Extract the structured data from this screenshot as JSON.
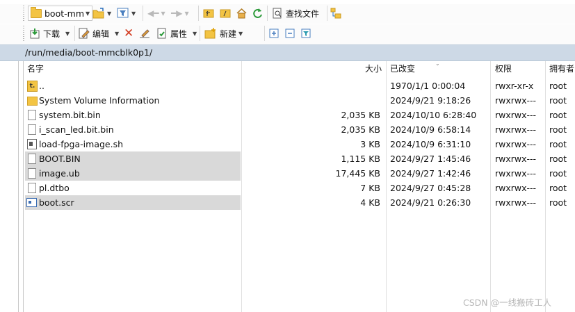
{
  "toolbar1": {
    "drive_label": "boot-mm",
    "find_files_label": "查找文件"
  },
  "toolbar2": {
    "download_label": "下载",
    "edit_label": "编辑",
    "properties_label": "属性",
    "new_label": "新建"
  },
  "path": "/run/media/boot-mmcblk0p1/",
  "columns": {
    "name": "名字",
    "size": "大小",
    "modified": "已改变",
    "permissions": "权限",
    "owner": "拥有者"
  },
  "files": [
    {
      "name": "..",
      "size": "",
      "modified": "1970/1/1 0:00:04",
      "perms": "rwxr-xr-x",
      "owner": "root",
      "icon": "parent-folder-icon",
      "selected": false
    },
    {
      "name": "System Volume Information",
      "size": "",
      "modified": "2024/9/21 9:18:26",
      "perms": "rwxrwx---",
      "owner": "root",
      "icon": "folder-icon",
      "selected": false
    },
    {
      "name": "system.bit.bin",
      "size": "2,035 KB",
      "modified": "2024/10/10 6:28:40",
      "perms": "rwxrwx---",
      "owner": "root",
      "icon": "file-icon",
      "selected": false
    },
    {
      "name": "i_scan_led.bit.bin",
      "size": "2,035 KB",
      "modified": "2024/10/9 6:58:14",
      "perms": "rwxrwx---",
      "owner": "root",
      "icon": "file-icon",
      "selected": false
    },
    {
      "name": "load-fpga-image.sh",
      "size": "3 KB",
      "modified": "2024/10/9 6:31:10",
      "perms": "rwxrwx---",
      "owner": "root",
      "icon": "script-icon",
      "selected": false
    },
    {
      "name": "BOOT.BIN",
      "size": "1,115 KB",
      "modified": "2024/9/27 1:45:46",
      "perms": "rwxrwx---",
      "owner": "root",
      "icon": "file-icon",
      "selected": true
    },
    {
      "name": "image.ub",
      "size": "17,445 KB",
      "modified": "2024/9/27 1:42:46",
      "perms": "rwxrwx---",
      "owner": "root",
      "icon": "file-icon",
      "selected": true
    },
    {
      "name": "pl.dtbo",
      "size": "7 KB",
      "modified": "2024/9/27 0:45:28",
      "perms": "rwxrwx---",
      "owner": "root",
      "icon": "file-icon",
      "selected": false
    },
    {
      "name": "boot.scr",
      "size": "4 KB",
      "modified": "2024/9/21 0:26:30",
      "perms": "rwxrwx---",
      "owner": "root",
      "icon": "boot-script-icon",
      "selected": true
    }
  ],
  "watermark": "CSDN @一线搬砖工人",
  "colors": {
    "path_bar": "#cdd9e6",
    "selection": "#d9d9d9",
    "folder": "#f3c443"
  }
}
